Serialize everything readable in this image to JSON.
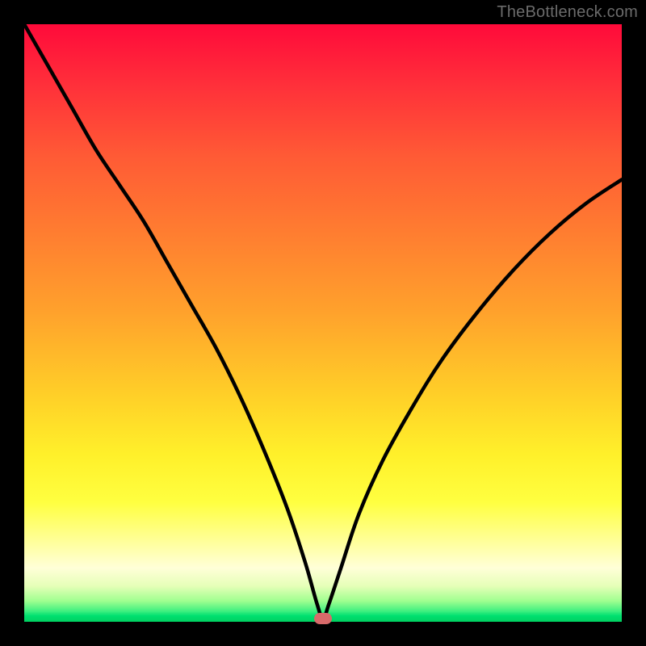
{
  "attribution": "TheBottleneck.com",
  "colors": {
    "frame": "#000000",
    "curve": "#000000",
    "marker": "#d86a6a",
    "gradient_top": "#ff0a3a",
    "gradient_bottom": "#00d060"
  },
  "chart_data": {
    "type": "line",
    "title": "",
    "xlabel": "",
    "ylabel": "",
    "xlim": [
      0,
      100
    ],
    "ylim": [
      0,
      100
    ],
    "x": [
      0,
      4,
      8,
      12,
      16,
      20,
      24,
      28,
      32,
      36,
      40,
      44,
      47,
      49,
      50,
      51,
      53,
      56,
      60,
      65,
      70,
      76,
      82,
      88,
      94,
      100
    ],
    "series": [
      {
        "name": "bottleneck-curve",
        "values": [
          100,
          93,
          86,
          79,
          73,
          67,
          60,
          53,
          46,
          38,
          29,
          19,
          10,
          3,
          0.5,
          3,
          9,
          18,
          27,
          36,
          44,
          52,
          59,
          65,
          70,
          74
        ]
      }
    ],
    "marker": {
      "x": 50,
      "y": 0.5
    },
    "annotations": []
  }
}
